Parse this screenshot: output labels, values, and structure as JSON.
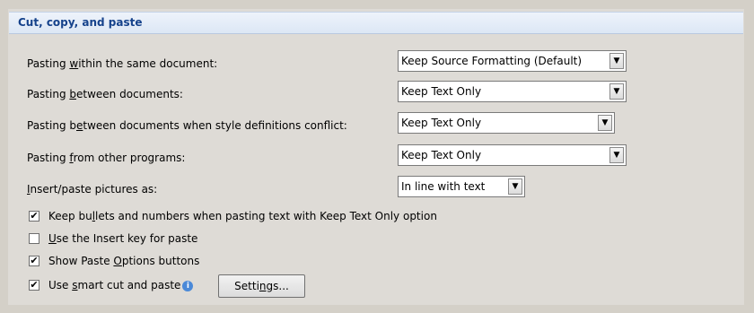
{
  "section": {
    "title": "Cut, copy, and paste"
  },
  "rows": [
    {
      "label_pre": "Pasting ",
      "label_key": "w",
      "label_post": "ithin the same document:",
      "value": "Keep Source Formatting (Default)"
    },
    {
      "label_pre": "Pasting ",
      "label_key": "b",
      "label_post": "etween documents:",
      "value": "Keep Text Only"
    },
    {
      "label_pre": "Pasting b",
      "label_key": "e",
      "label_post": "tween documents when style definitions conflict:",
      "value": "Keep Text Only"
    },
    {
      "label_pre": "Pasting ",
      "label_key": "f",
      "label_post": "rom other programs:",
      "value": "Keep Text Only"
    },
    {
      "label_pre": "",
      "label_key": "I",
      "label_post": "nsert/paste pictures as:",
      "value": "In line with text"
    }
  ],
  "checks": [
    {
      "label_pre": "Keep bu",
      "label_key": "l",
      "label_post": "lets and numbers when pasting text with Keep Text Only option",
      "checked": true
    },
    {
      "label_pre": "",
      "label_key": "U",
      "label_post": "se the Insert key for paste",
      "checked": false
    },
    {
      "label_pre": "Show Paste ",
      "label_key": "O",
      "label_post": "ptions buttons",
      "checked": true
    },
    {
      "label_pre": "Use ",
      "label_key": "s",
      "label_post": "mart cut and paste",
      "checked": true
    }
  ],
  "check_mark": "✔",
  "info_glyph": "i",
  "arrow_glyph": "▼",
  "settings_button": {
    "label_pre": "Setti",
    "label_key": "n",
    "label_post": "gs..."
  }
}
